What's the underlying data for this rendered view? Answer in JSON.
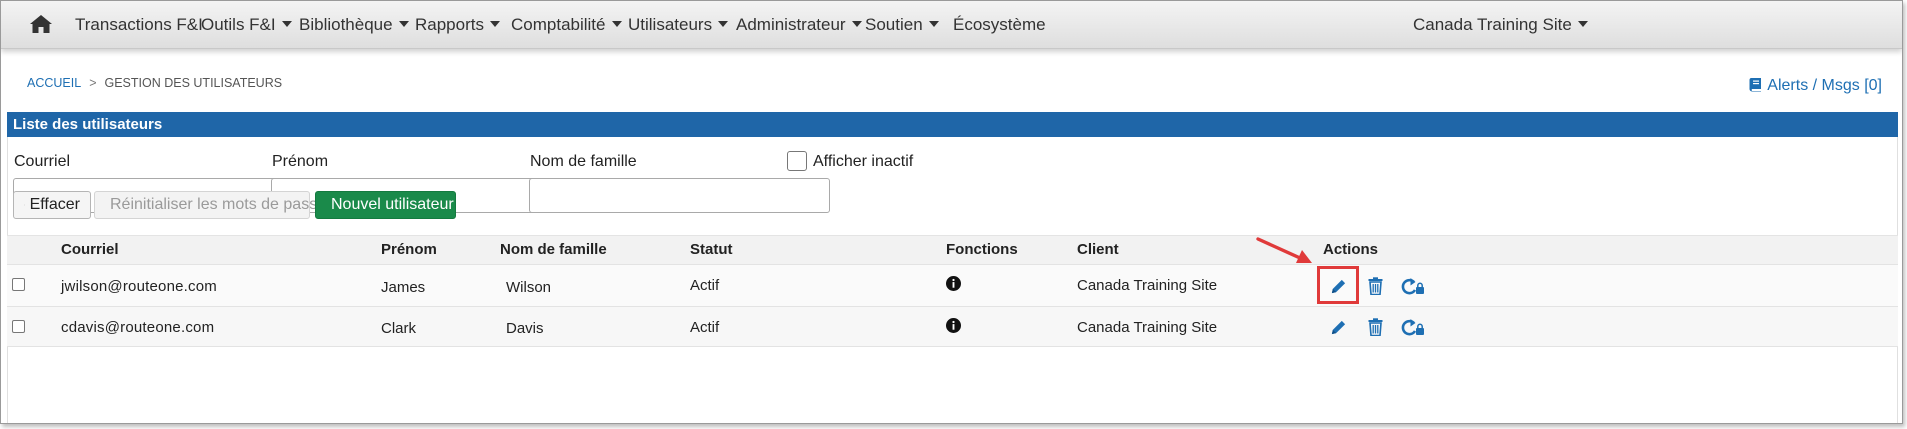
{
  "nav": {
    "items": [
      {
        "label": "Transactions F&I",
        "dropdown": false
      },
      {
        "label": "Outils F&I",
        "dropdown": true
      },
      {
        "label": "Bibliothèque",
        "dropdown": true
      },
      {
        "label": "Rapports",
        "dropdown": true
      },
      {
        "label": "Comptabilité",
        "dropdown": true
      },
      {
        "label": "Utilisateurs",
        "dropdown": true
      },
      {
        "label": "Administrateur",
        "dropdown": true
      },
      {
        "label": "Soutien",
        "dropdown": true
      },
      {
        "label": "Écosystème",
        "dropdown": false
      }
    ],
    "site": "Canada Training Site"
  },
  "breadcrumb": {
    "home": "ACCUEIL",
    "separator": ">",
    "current": "GESTION DES UTILISATEURS"
  },
  "alerts": "Alerts / Msgs [0]",
  "panel": {
    "title": "Liste des utilisateurs"
  },
  "filters": {
    "email_label": "Courriel",
    "email_value": "",
    "first_label": "Prénom",
    "first_value": "",
    "last_label": "Nom de famille",
    "last_value": "",
    "inactive_label": "Afficher inactif",
    "inactive_checked": false
  },
  "buttons": {
    "clear": "Effacer",
    "reset": "Réinitialiser les mots de passe",
    "new_user": "Nouvel utilisateur"
  },
  "table": {
    "headers": {
      "email": "Courriel",
      "first": "Prénom",
      "last": "Nom de famille",
      "status": "Statut",
      "functions": "Fonctions",
      "client": "Client",
      "actions": "Actions"
    },
    "rows": [
      {
        "email": "jwilson@routeone.com",
        "first": "James",
        "last": "Wilson",
        "status": "Actif",
        "client": "Canada Training Site"
      },
      {
        "email": "cdavis@routeone.com",
        "first": "Clark",
        "last": "Davis",
        "status": "Actif",
        "client": "Canada Training Site"
      }
    ]
  },
  "colors": {
    "link": "#1e6fb3",
    "panel_header": "#1f66a8",
    "primary_button": "#1a8a4a",
    "highlight": "#e03a3a"
  }
}
